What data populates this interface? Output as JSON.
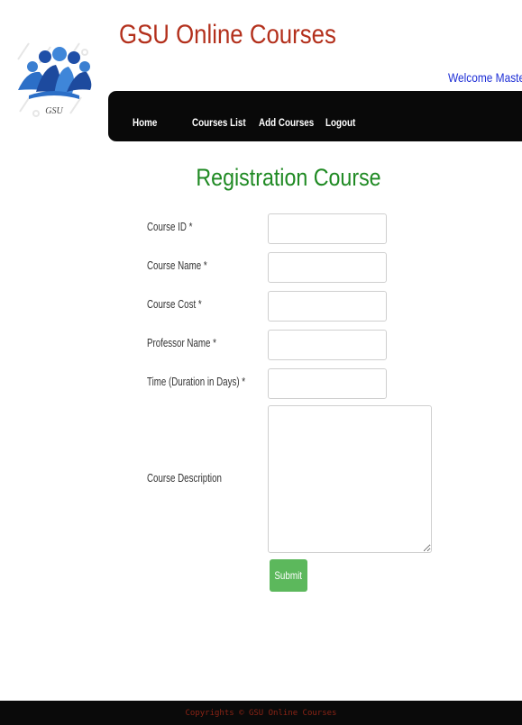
{
  "header": {
    "logo_text": "GSU",
    "title": "GSU Online Courses",
    "welcome": "Welcome Master"
  },
  "nav": {
    "items": [
      "Home",
      "Courses List",
      "Add Courses",
      "Logout"
    ]
  },
  "form": {
    "heading": "Registration Course",
    "fields": [
      {
        "label": "Course ID *",
        "value": ""
      },
      {
        "label": "Course Name *",
        "value": ""
      },
      {
        "label": "Course Cost *",
        "value": ""
      },
      {
        "label": "Professor Name *",
        "value": ""
      },
      {
        "label": "Time (Duration in Days) *",
        "value": ""
      },
      {
        "label": "Course Description",
        "value": ""
      }
    ],
    "submit_label": "Submit"
  },
  "footer": {
    "text": "Copyrights © GSU Online Courses"
  },
  "colors": {
    "title": "#b3301c",
    "welcome": "#1e2fd6",
    "heading": "#1f8a23",
    "submit": "#5cb85c",
    "navbar": "#090909"
  }
}
